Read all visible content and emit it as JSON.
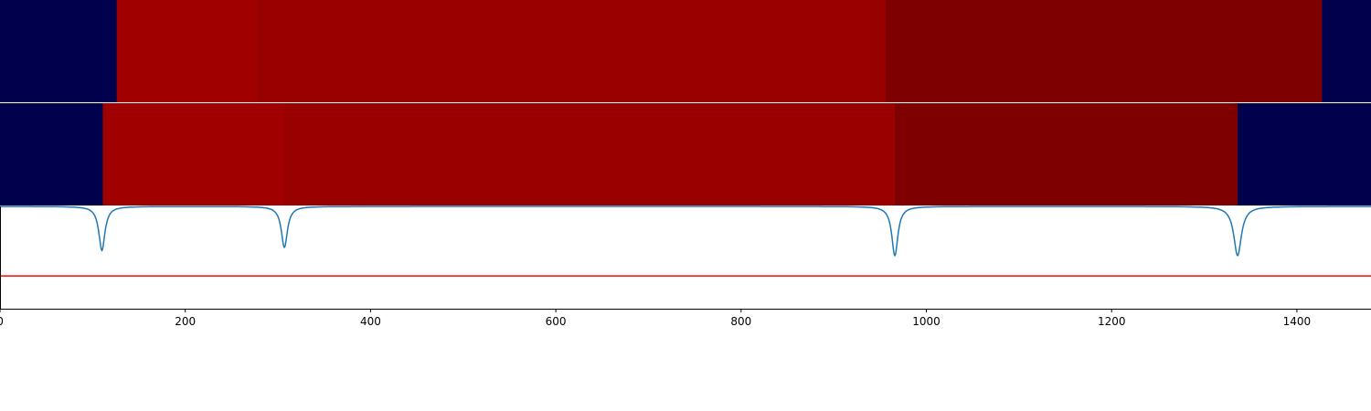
{
  "chart_data": {
    "type": "heatmap",
    "xlim": [
      0,
      1480
    ],
    "x_ticks": [
      0,
      200,
      400,
      600,
      800,
      1000,
      1200,
      1400
    ],
    "x_tick_labels": [
      "0",
      "200",
      "400",
      "600",
      "800",
      "1000",
      "1200",
      "1400"
    ],
    "rows": [
      {
        "segments": [
          {
            "start": 0,
            "end": 126,
            "color": "#00004c"
          },
          {
            "start": 126,
            "end": 278,
            "color": "#a00000"
          },
          {
            "start": 278,
            "end": 956,
            "color": "#990000"
          },
          {
            "start": 956,
            "end": 1427,
            "color": "#7f0000"
          },
          {
            "start": 1427,
            "end": 1480,
            "color": "#00004c"
          }
        ]
      },
      {
        "segments": [
          {
            "start": 0,
            "end": 111,
            "color": "#00004c"
          },
          {
            "start": 111,
            "end": 307,
            "color": "#a00000"
          },
          {
            "start": 307,
            "end": 966,
            "color": "#990000"
          },
          {
            "start": 966,
            "end": 1336,
            "color": "#7f0000"
          },
          {
            "start": 1336,
            "end": 1480,
            "color": "#00004c"
          }
        ]
      }
    ],
    "signal": {
      "color": "#1f77b4",
      "baseline": 0,
      "ylim": [
        -1.0,
        0.0
      ],
      "dips": [
        {
          "x": 110,
          "depth": 0.43,
          "width": 4
        },
        {
          "x": 307,
          "depth": 0.4,
          "width": 4
        },
        {
          "x": 966,
          "depth": 0.48,
          "width": 4
        },
        {
          "x": 1336,
          "depth": 0.48,
          "width": 5
        }
      ]
    },
    "threshold": {
      "y": -0.68,
      "color": "#ff0000"
    }
  }
}
